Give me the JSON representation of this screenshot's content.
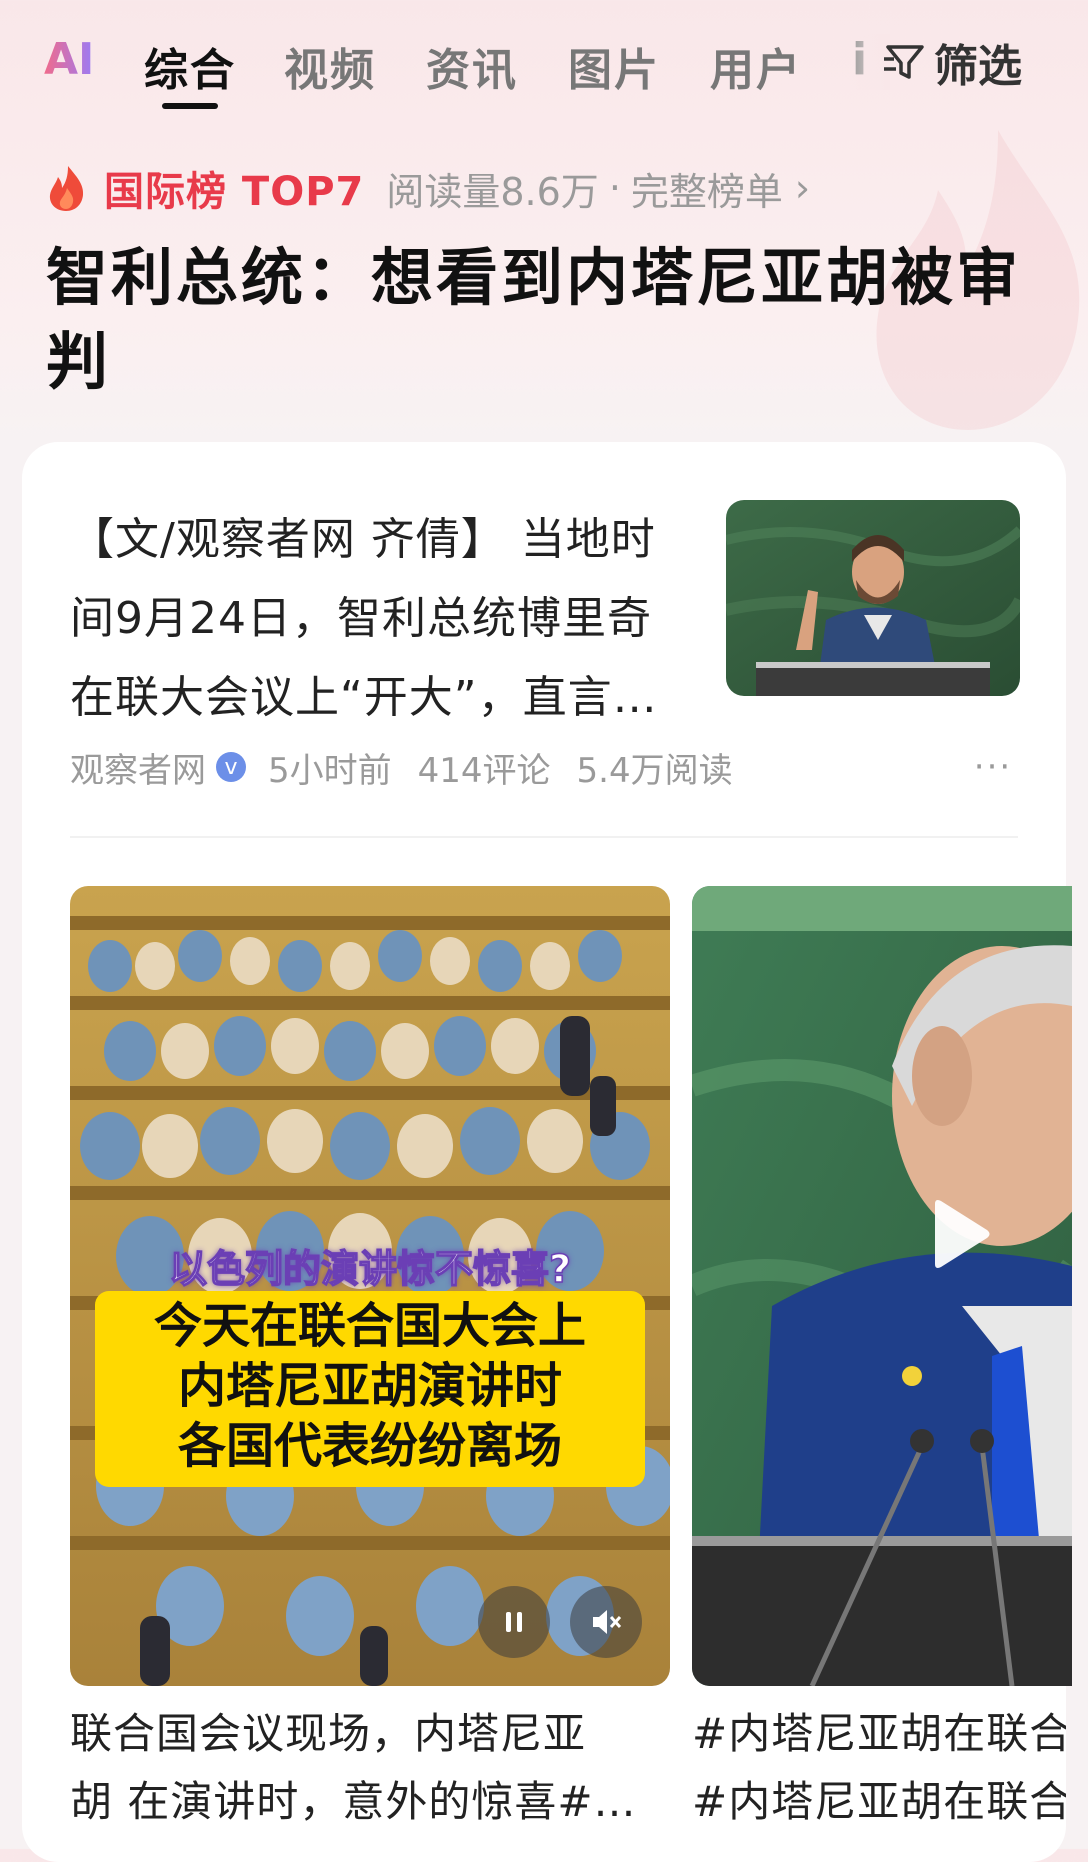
{
  "tabs": {
    "ai_label": "AI",
    "items": [
      {
        "label": "综合",
        "active": true
      },
      {
        "label": "视频",
        "active": false
      },
      {
        "label": "资讯",
        "active": false
      },
      {
        "label": "图片",
        "active": false
      },
      {
        "label": "用户",
        "active": false
      },
      {
        "label": "i",
        "active": false
      }
    ],
    "filter_label": "筛选"
  },
  "hot": {
    "rank": "国际榜 TOP7",
    "reads": "阅读量8.6万",
    "separator": "·",
    "full_list": "完整榜单",
    "chevron": "›",
    "accent_color": "#e83a4a"
  },
  "headline": "智利总统：想看到内塔尼亚胡被审判",
  "article": {
    "lines": [
      "【文/观察者网 齐倩】 当地时",
      "间9月24日，智利总统博里奇",
      "在联大会议上“开大”，直言…"
    ],
    "source": "观察者网",
    "verified_badge": "v",
    "time": "5小时前",
    "comments": "414评论",
    "reads": "5.4万阅读",
    "more": "···"
  },
  "video1": {
    "overlay_question": "以色列的演讲惊不惊喜?",
    "overlay_lines": [
      "今天在联合国大会上",
      "内塔尼亚胡演讲时",
      "各国代表纷纷离场"
    ],
    "caption_lines": [
      "联合国会议现场，内塔尼亚",
      "胡 在演讲时，意外的惊喜#…"
    ]
  },
  "video2": {
    "caption_lines": [
      "#内塔尼亚胡在联合",
      "#内塔尼亚胡在联合"
    ]
  },
  "icons": [
    "flame-icon",
    "filter-icon",
    "verified-icon",
    "more-icon",
    "pause-icon",
    "mute-icon",
    "play-icon"
  ]
}
